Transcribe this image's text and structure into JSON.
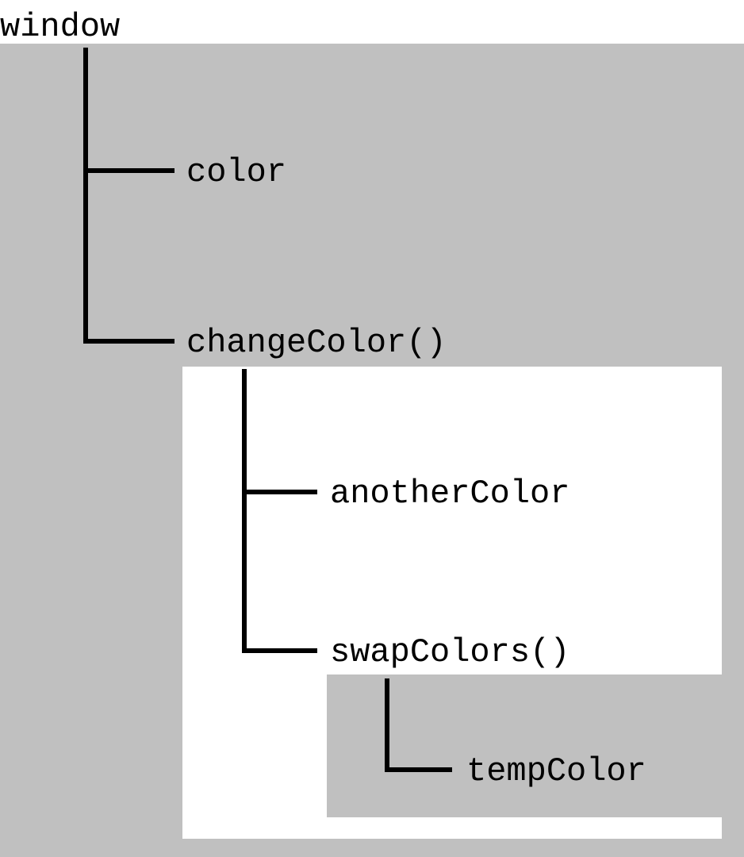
{
  "tree": {
    "root": "window",
    "child1": "color",
    "child2": "changeColor()",
    "grandchild1": "anotherColor",
    "grandchild2": "swapColors()",
    "greatgrandchild": "tempColor"
  }
}
